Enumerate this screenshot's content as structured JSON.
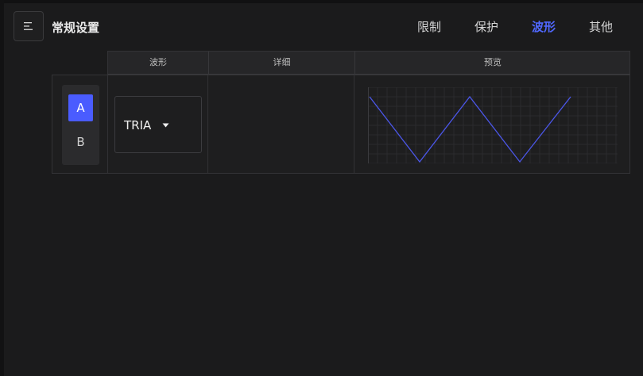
{
  "header": {
    "title": "常规设置",
    "menu_icon": "menu-icon"
  },
  "tabs": [
    {
      "label": "限制",
      "active": false
    },
    {
      "label": "保护",
      "active": false
    },
    {
      "label": "波形",
      "active": true
    },
    {
      "label": "其他",
      "active": false
    }
  ],
  "table": {
    "columns": [
      "波形",
      "详细",
      "预览"
    ]
  },
  "channels": [
    {
      "label": "A",
      "active": true
    },
    {
      "label": "B",
      "active": false
    }
  ],
  "waveform_select": {
    "value": "TRIA",
    "icon": "caret-down-icon"
  },
  "preview": {
    "waveform": "triangle",
    "line_color": "#4b56e8",
    "grid": true
  },
  "colors": {
    "accent": "#4a5cff",
    "active_tab": "#5068ff",
    "background": "#1b1b1c"
  }
}
